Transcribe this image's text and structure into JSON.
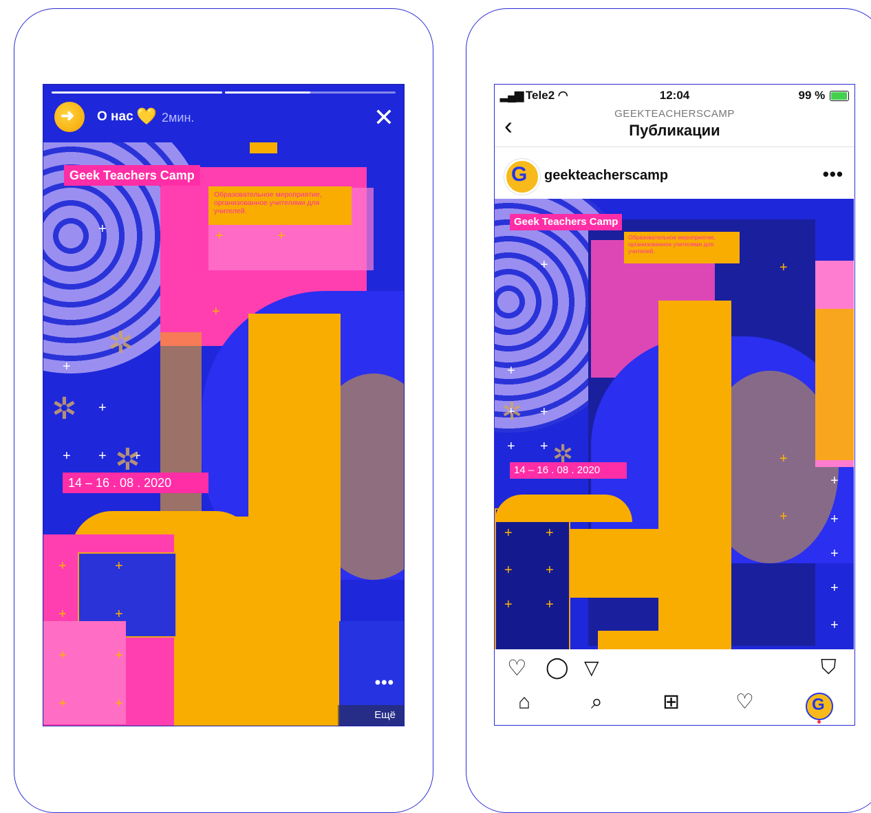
{
  "story": {
    "account_label": "О нас",
    "heart": "💛",
    "time_ago": "2мин.",
    "close_icon": "✕",
    "avatar_glyph": "➜",
    "event_name": "Geek Teachers Camp",
    "description": "Образовательное мероприятие, организованное учителями для учителей.",
    "dates": "14 – 16 . 08 . 2020",
    "more_dots": "•••",
    "more_label": "Ещё",
    "progress": [
      1.0,
      0.5,
      0.0
    ]
  },
  "phone": {
    "status": {
      "carrier": "Tele2",
      "signal": "▂▄▆",
      "wifi": "◠",
      "time": "12:04",
      "battery": "99 %"
    },
    "nav": {
      "back_icon": "‹",
      "subtitle": "GEEKTEACHERSCAMP",
      "title": "Публикации"
    },
    "post": {
      "username": "geekteacherscamp",
      "more_icon": "•••",
      "avatar_glyph": "G",
      "event_name": "Geek Teachers Camp",
      "description": "Образовательное мероприятие, организованное учителями для учителей.",
      "dates": "14 – 16 . 08 . 2020"
    },
    "actions": {
      "like_icon": "♡",
      "comment_icon": "◯",
      "share_icon": "▽",
      "save_icon": "⛉"
    },
    "tabbar": {
      "home_icon": "⌂",
      "search_icon": "⌕",
      "add_icon": "⊞",
      "activity_icon": "♡",
      "profile_glyph": "G"
    }
  },
  "colors": {
    "brand_blue": "#1e27d9",
    "brand_pink": "#ff2ea6",
    "brand_gold": "#f8ad00",
    "frame_blue": "#2b2bd6"
  }
}
